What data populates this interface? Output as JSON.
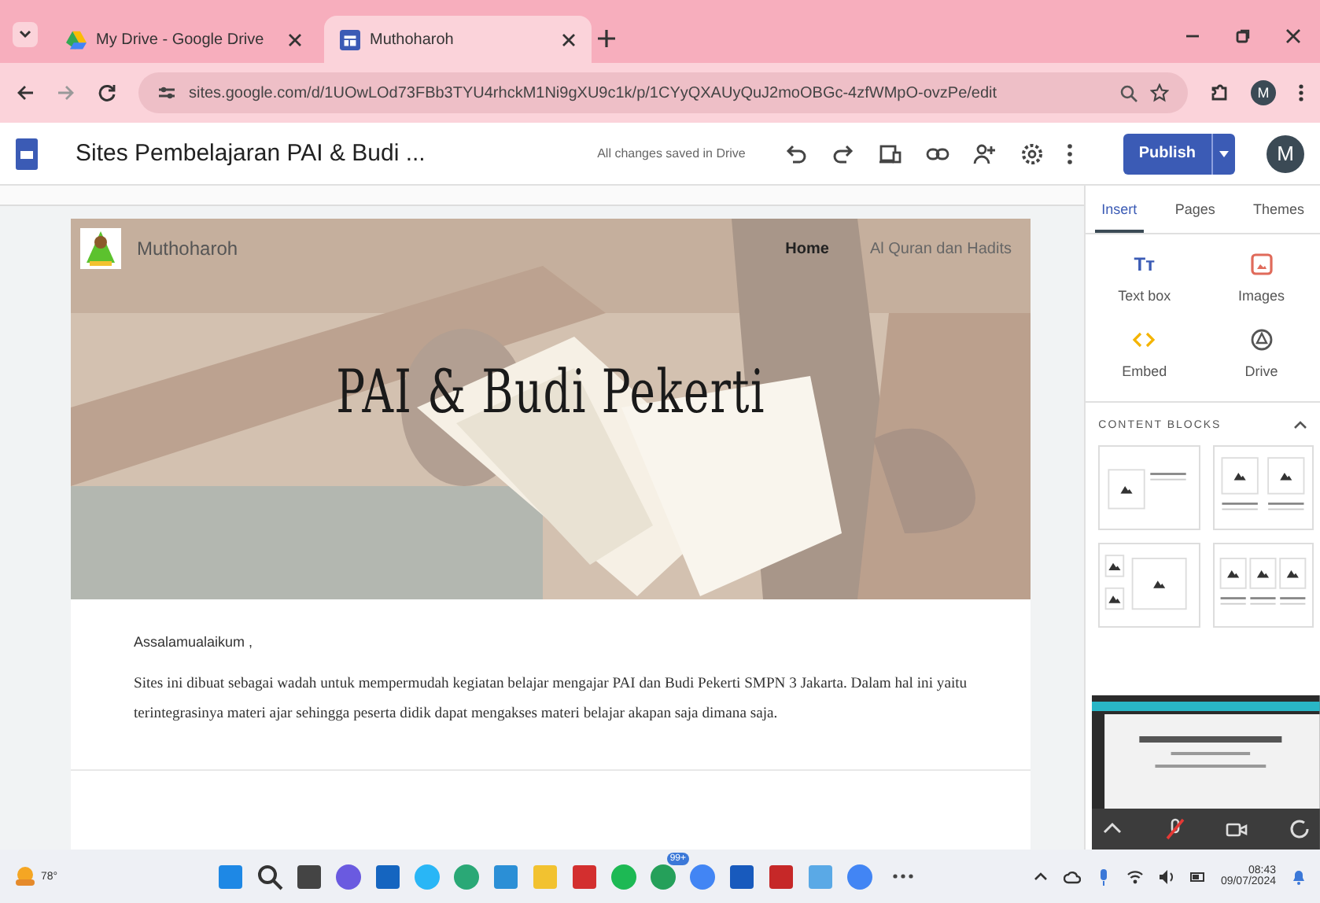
{
  "browser": {
    "tabs": [
      {
        "title": "My Drive - Google Drive",
        "selected": false,
        "kind": "drive"
      },
      {
        "title": "Muthoharoh",
        "selected": true,
        "kind": "sites"
      }
    ],
    "url": "sites.google.com/d/1UOwLOd73FBb3TYU4rhckM1Ni9gXU9c1k/p/1CYyQXAUyQuJ2moOBGc-4zfWMpO-ovzPe/edit",
    "profile": "M"
  },
  "editor": {
    "title": "Sites Pembelajaran PAI & Budi ...",
    "save_status": "All changes saved in Drive",
    "publish": "Publish",
    "avatar": "M"
  },
  "site": {
    "name": "Muthoharoh",
    "nav": [
      {
        "label": "Home",
        "selected": true
      },
      {
        "label": "Al Quran dan Hadits",
        "selected": false
      }
    ],
    "title": "PAI & Budi Pekerti",
    "greeting": "Assalamualaikum ,",
    "body": "Sites ini dibuat sebagai wadah untuk mempermudah kegiatan belajar mengajar PAI dan Budi Pekerti SMPN 3 Jakarta. Dalam hal ini yaitu terintegrasinya materi ajar sehingga peserta didik dapat mengakses materi belajar akapan saja dimana saja."
  },
  "panel": {
    "tabs": [
      {
        "label": "Insert",
        "selected": true
      },
      {
        "label": "Pages",
        "selected": false
      },
      {
        "label": "Themes",
        "selected": false
      }
    ],
    "items": [
      {
        "label": "Text box",
        "kind": "textbox",
        "glyph": "Tт"
      },
      {
        "label": "Images",
        "kind": "images"
      },
      {
        "label": "Embed",
        "kind": "embed"
      },
      {
        "label": "Drive",
        "kind": "drive"
      }
    ],
    "content_blocks": {
      "heading": "CONTENT BLOCKS",
      "expanded": true
    }
  },
  "taskbar": {
    "weather": "78°",
    "badge": "99+",
    "time": "08:43",
    "date": "09/07/2024"
  }
}
